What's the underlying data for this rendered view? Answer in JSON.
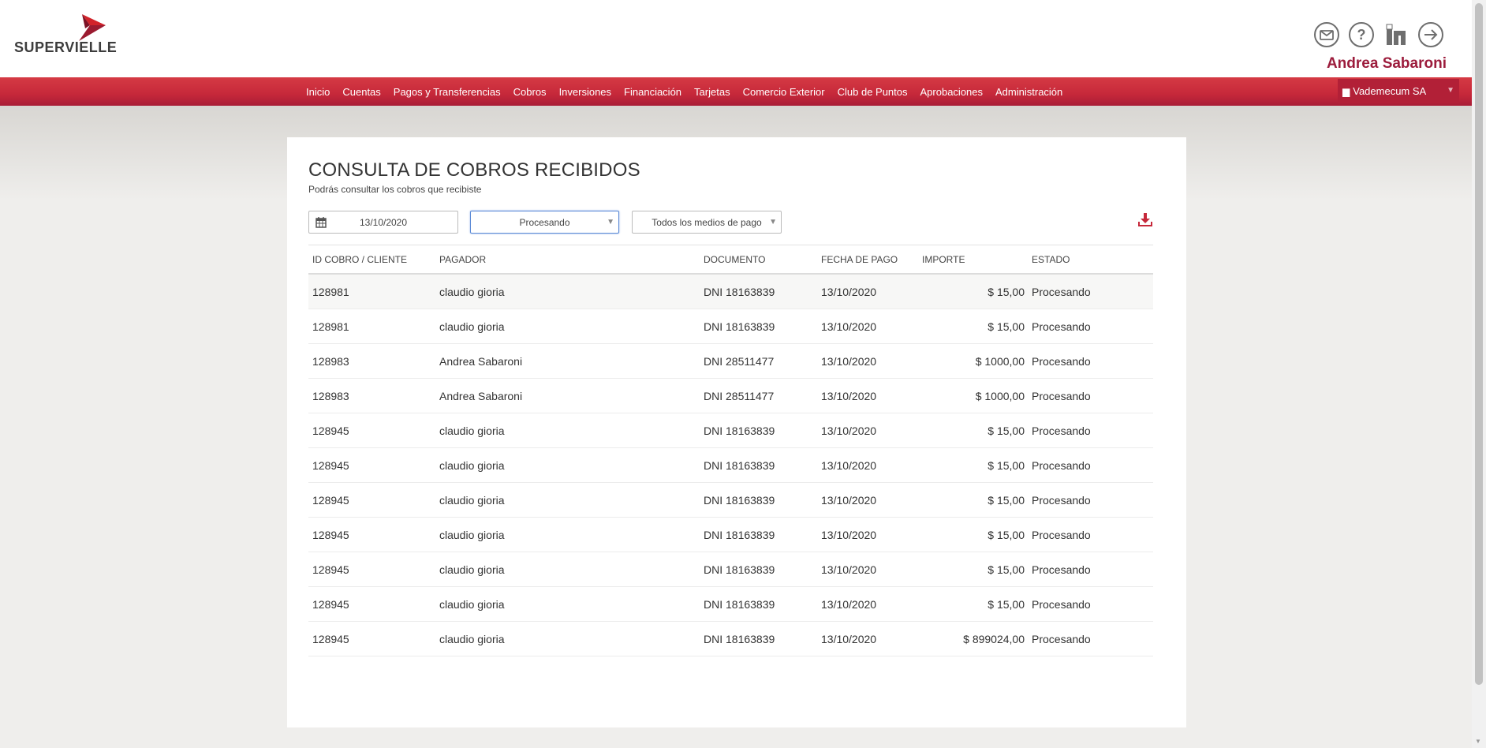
{
  "brand": {
    "name": "SUPERVIELLE",
    "primary_color": "#c6283a",
    "user_name_color": "#9c1c3c"
  },
  "header": {
    "icons": [
      "mail-icon",
      "help-icon",
      "info-icon",
      "logout-icon"
    ],
    "user_name": "Andrea Sabaroni"
  },
  "nav": {
    "items": [
      "Inicio",
      "Cuentas",
      "Pagos y Transferencias",
      "Cobros",
      "Inversiones",
      "Financiación",
      "Tarjetas",
      "Comercio Exterior",
      "Club de Puntos",
      "Aprobaciones",
      "Administración"
    ],
    "company": "Vademecum SA"
  },
  "page": {
    "title": "CONSULTA DE COBROS RECIBIDOS",
    "subtitle": "Podrás consultar los cobros que recibiste"
  },
  "filters": {
    "date": "13/10/2020",
    "status": "Procesando",
    "payment_method": "Todos los medios de pago"
  },
  "table": {
    "headers": {
      "id": "ID COBRO / CLIENTE",
      "pagador": "PAGADOR",
      "documento": "DOCUMENTO",
      "fecha": "FECHA DE PAGO",
      "importe": "IMPORTE",
      "estado": "ESTADO"
    },
    "rows": [
      {
        "id": "128981",
        "pagador": "claudio gioria",
        "documento": "DNI 18163839",
        "fecha": "13/10/2020",
        "importe": "$ 15,00",
        "estado": "Procesando"
      },
      {
        "id": "128981",
        "pagador": "claudio gioria",
        "documento": "DNI 18163839",
        "fecha": "13/10/2020",
        "importe": "$ 15,00",
        "estado": "Procesando"
      },
      {
        "id": "128983",
        "pagador": "Andrea Sabaroni",
        "documento": "DNI 28511477",
        "fecha": "13/10/2020",
        "importe": "$ 1000,00",
        "estado": "Procesando"
      },
      {
        "id": "128983",
        "pagador": "Andrea Sabaroni",
        "documento": "DNI 28511477",
        "fecha": "13/10/2020",
        "importe": "$ 1000,00",
        "estado": "Procesando"
      },
      {
        "id": "128945",
        "pagador": "claudio gioria",
        "documento": "DNI 18163839",
        "fecha": "13/10/2020",
        "importe": "$ 15,00",
        "estado": "Procesando"
      },
      {
        "id": "128945",
        "pagador": "claudio gioria",
        "documento": "DNI 18163839",
        "fecha": "13/10/2020",
        "importe": "$ 15,00",
        "estado": "Procesando"
      },
      {
        "id": "128945",
        "pagador": "claudio gioria",
        "documento": "DNI 18163839",
        "fecha": "13/10/2020",
        "importe": "$ 15,00",
        "estado": "Procesando"
      },
      {
        "id": "128945",
        "pagador": "claudio gioria",
        "documento": "DNI 18163839",
        "fecha": "13/10/2020",
        "importe": "$ 15,00",
        "estado": "Procesando"
      },
      {
        "id": "128945",
        "pagador": "claudio gioria",
        "documento": "DNI 18163839",
        "fecha": "13/10/2020",
        "importe": "$ 15,00",
        "estado": "Procesando"
      },
      {
        "id": "128945",
        "pagador": "claudio gioria",
        "documento": "DNI 18163839",
        "fecha": "13/10/2020",
        "importe": "$ 15,00",
        "estado": "Procesando"
      },
      {
        "id": "128945",
        "pagador": "claudio gioria",
        "documento": "DNI 18163839",
        "fecha": "13/10/2020",
        "importe": "$ 899024,00",
        "estado": "Procesando"
      }
    ]
  }
}
